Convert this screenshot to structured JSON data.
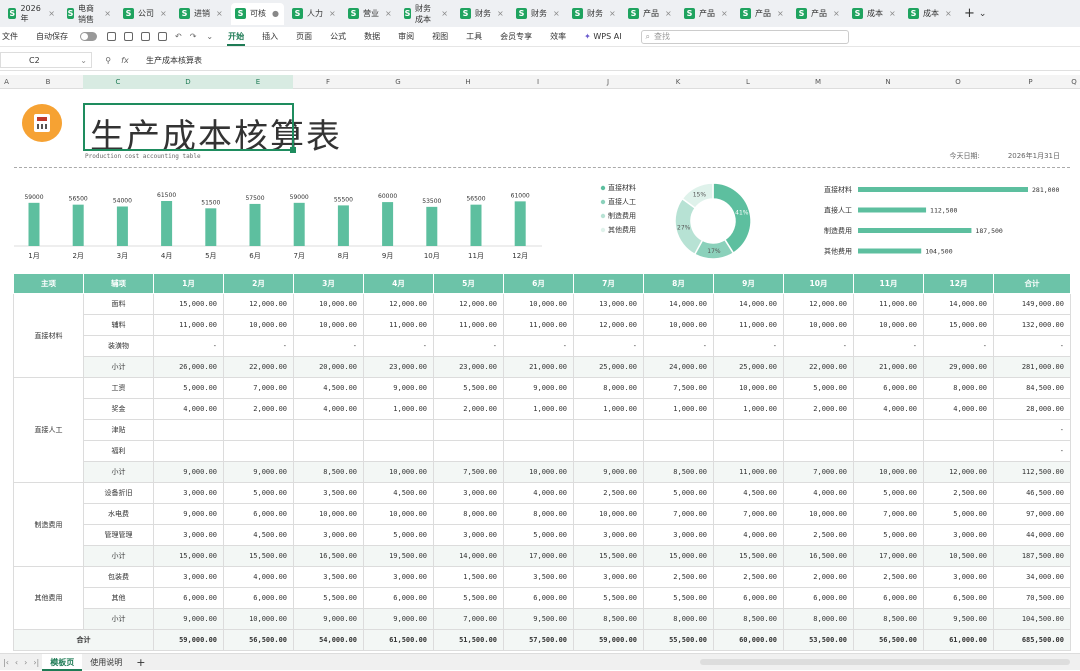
{
  "tabs": [
    {
      "label": "2026年",
      "active": false
    },
    {
      "label": "电商销售",
      "active": false
    },
    {
      "label": "公司",
      "active": false
    },
    {
      "label": "进销",
      "active": false
    },
    {
      "label": "可核",
      "active": true
    },
    {
      "label": "人力",
      "active": false
    },
    {
      "label": "营业",
      "active": false
    },
    {
      "label": "财务成本",
      "active": false
    },
    {
      "label": "财务",
      "active": false
    },
    {
      "label": "财务",
      "active": false
    },
    {
      "label": "财务",
      "active": false
    },
    {
      "label": "产品",
      "active": false
    },
    {
      "label": "产品",
      "active": false
    },
    {
      "label": "产品",
      "active": false
    },
    {
      "label": "产品",
      "active": false
    },
    {
      "label": "成本",
      "active": false
    },
    {
      "label": "成本",
      "active": false
    }
  ],
  "menu": {
    "file": "文件",
    "autosave": "自动保存",
    "items": [
      "开始",
      "插入",
      "页面",
      "公式",
      "数据",
      "审阅",
      "视图",
      "工具",
      "会员专享",
      "效率"
    ],
    "active_index": 0,
    "wps_ai": "WPS AI",
    "search_placeholder": "查找"
  },
  "formula": {
    "cell": "C2",
    "fx": "fx",
    "content": "生产成本核算表"
  },
  "columns": [
    "A",
    "B",
    "C",
    "D",
    "E",
    "F",
    "G",
    "H",
    "I",
    "J",
    "K",
    "L",
    "M",
    "N",
    "O",
    "P",
    "Q"
  ],
  "selected_columns": [
    "C",
    "D",
    "E"
  ],
  "header": {
    "title": "生产成本核算表",
    "subtitle": "Production cost accounting table",
    "date_label": "今天日期:",
    "date_value": "2026年1月31日"
  },
  "chart_data": [
    {
      "type": "bar",
      "categories": [
        "1月",
        "2月",
        "3月",
        "4月",
        "5月",
        "6月",
        "7月",
        "8月",
        "9月",
        "10月",
        "11月",
        "12月"
      ],
      "values": [
        59000,
        56500,
        54000,
        61500,
        51500,
        57500,
        59000,
        55500,
        60000,
        53500,
        56500,
        61000
      ],
      "color": "#5dbf9f"
    },
    {
      "type": "pie",
      "labels": [
        "直接材料",
        "直接人工",
        "制造费用",
        "其他费用"
      ],
      "values": [
        41,
        17,
        27,
        15
      ],
      "colors": [
        "#5dbf9f",
        "#8bd1bb",
        "#b7e2d4",
        "#dff2eb"
      ]
    },
    {
      "type": "bar",
      "orientation": "horizontal",
      "categories": [
        "直接材料",
        "直接人工",
        "制造费用",
        "其他费用"
      ],
      "values": [
        281000,
        112500,
        187500,
        104500
      ],
      "labels": [
        "281,000",
        "112,500",
        "187,500",
        "104,500"
      ],
      "color": "#5dbf9f"
    }
  ],
  "table": {
    "headers": [
      "主项",
      "辅项",
      "1月",
      "2月",
      "3月",
      "4月",
      "5月",
      "6月",
      "7月",
      "8月",
      "9月",
      "10月",
      "11月",
      "12月",
      "合计"
    ],
    "groups": [
      {
        "main": "直接材料",
        "rows": [
          {
            "sub": "面料",
            "values": [
              "15,000.00",
              "12,000.00",
              "10,000.00",
              "12,000.00",
              "12,000.00",
              "10,000.00",
              "13,000.00",
              "14,000.00",
              "14,000.00",
              "12,000.00",
              "11,000.00",
              "14,000.00",
              "149,000.00"
            ]
          },
          {
            "sub": "辅料",
            "values": [
              "11,000.00",
              "10,000.00",
              "10,000.00",
              "11,000.00",
              "11,000.00",
              "11,000.00",
              "12,000.00",
              "10,000.00",
              "11,000.00",
              "10,000.00",
              "10,000.00",
              "15,000.00",
              "132,000.00"
            ]
          },
          {
            "sub": "装潢物",
            "values": [
              "-",
              "-",
              "-",
              "-",
              "-",
              "-",
              "-",
              "-",
              "-",
              "-",
              "-",
              "-",
              "-"
            ]
          },
          {
            "sub": "小计",
            "subtotal": true,
            "values": [
              "26,000.00",
              "22,000.00",
              "20,000.00",
              "23,000.00",
              "23,000.00",
              "21,000.00",
              "25,000.00",
              "24,000.00",
              "25,000.00",
              "22,000.00",
              "21,000.00",
              "29,000.00",
              "281,000.00"
            ]
          }
        ]
      },
      {
        "main": "直接人工",
        "rows": [
          {
            "sub": "工资",
            "values": [
              "5,000.00",
              "7,000.00",
              "4,500.00",
              "9,000.00",
              "5,500.00",
              "9,000.00",
              "8,000.00",
              "7,500.00",
              "10,000.00",
              "5,000.00",
              "6,000.00",
              "8,000.00",
              "84,500.00"
            ]
          },
          {
            "sub": "奖金",
            "values": [
              "4,000.00",
              "2,000.00",
              "4,000.00",
              "1,000.00",
              "2,000.00",
              "1,000.00",
              "1,000.00",
              "1,000.00",
              "1,000.00",
              "2,000.00",
              "4,000.00",
              "4,000.00",
              "28,000.00"
            ]
          },
          {
            "sub": "津贴",
            "values": [
              "",
              "",
              "",
              "",
              "",
              "",
              "",
              "",
              "",
              "",
              "",
              "",
              "-"
            ]
          },
          {
            "sub": "福利",
            "values": [
              "",
              "",
              "",
              "",
              "",
              "",
              "",
              "",
              "",
              "",
              "",
              "",
              "-"
            ]
          },
          {
            "sub": "小计",
            "subtotal": true,
            "values": [
              "9,000.00",
              "9,000.00",
              "8,500.00",
              "10,000.00",
              "7,500.00",
              "10,000.00",
              "9,000.00",
              "8,500.00",
              "11,000.00",
              "7,000.00",
              "10,000.00",
              "12,000.00",
              "112,500.00"
            ]
          }
        ]
      },
      {
        "main": "制造费用",
        "rows": [
          {
            "sub": "设备折旧",
            "values": [
              "3,000.00",
              "5,000.00",
              "3,500.00",
              "4,500.00",
              "3,000.00",
              "4,000.00",
              "2,500.00",
              "5,000.00",
              "4,500.00",
              "4,000.00",
              "5,000.00",
              "2,500.00",
              "46,500.00"
            ]
          },
          {
            "sub": "水电费",
            "values": [
              "9,000.00",
              "6,000.00",
              "10,000.00",
              "10,000.00",
              "8,000.00",
              "8,000.00",
              "10,000.00",
              "7,000.00",
              "7,000.00",
              "10,000.00",
              "7,000.00",
              "5,000.00",
              "97,000.00"
            ]
          },
          {
            "sub": "管理管理",
            "values": [
              "3,000.00",
              "4,500.00",
              "3,000.00",
              "5,000.00",
              "3,000.00",
              "5,000.00",
              "3,000.00",
              "3,000.00",
              "4,000.00",
              "2,500.00",
              "5,000.00",
              "3,000.00",
              "44,000.00"
            ]
          },
          {
            "sub": "小计",
            "subtotal": true,
            "values": [
              "15,000.00",
              "15,500.00",
              "16,500.00",
              "19,500.00",
              "14,000.00",
              "17,000.00",
              "15,500.00",
              "15,000.00",
              "15,500.00",
              "16,500.00",
              "17,000.00",
              "10,500.00",
              "187,500.00"
            ]
          }
        ]
      },
      {
        "main": "其他费用",
        "rows": [
          {
            "sub": "包装费",
            "values": [
              "3,000.00",
              "4,000.00",
              "3,500.00",
              "3,000.00",
              "1,500.00",
              "3,500.00",
              "3,000.00",
              "2,500.00",
              "2,500.00",
              "2,000.00",
              "2,500.00",
              "3,000.00",
              "34,000.00"
            ]
          },
          {
            "sub": "其他",
            "values": [
              "6,000.00",
              "6,000.00",
              "5,500.00",
              "6,000.00",
              "5,500.00",
              "6,000.00",
              "5,500.00",
              "5,500.00",
              "6,000.00",
              "6,000.00",
              "6,000.00",
              "6,500.00",
              "70,500.00"
            ]
          },
          {
            "sub": "小计",
            "subtotal": true,
            "values": [
              "9,000.00",
              "10,000.00",
              "9,000.00",
              "9,000.00",
              "7,000.00",
              "9,500.00",
              "8,500.00",
              "8,000.00",
              "8,500.00",
              "8,000.00",
              "8,500.00",
              "9,500.00",
              "104,500.00"
            ]
          }
        ]
      }
    ],
    "total": {
      "label": "合计",
      "values": [
        "59,000.00",
        "56,500.00",
        "54,000.00",
        "61,500.00",
        "51,500.00",
        "57,500.00",
        "59,000.00",
        "55,500.00",
        "60,000.00",
        "53,500.00",
        "56,500.00",
        "61,000.00",
        "685,500.00"
      ]
    }
  },
  "sheets": [
    {
      "label": "模板页",
      "active": true
    },
    {
      "label": "使用说明",
      "active": false
    }
  ],
  "colors": {
    "accent": "#1e7b55",
    "header_bg": "#6cc3a8",
    "bar": "#5dbf9f"
  }
}
